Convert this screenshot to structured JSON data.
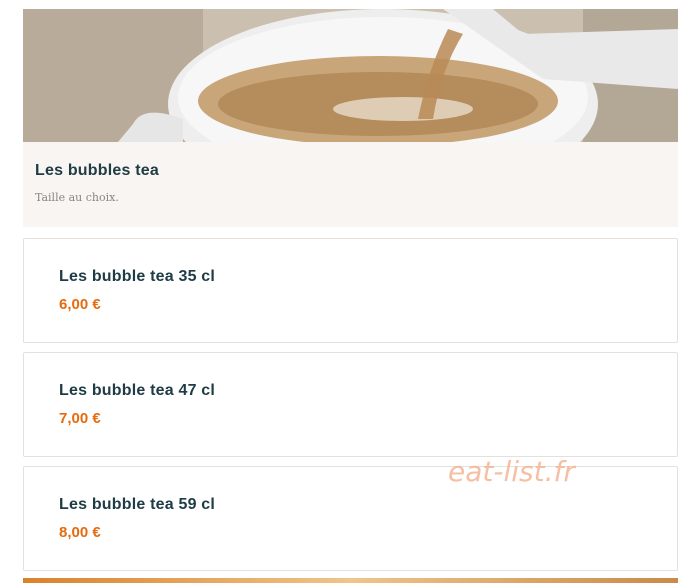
{
  "category": {
    "image_alt_icon": "tea-cup-image",
    "title": "Les bubbles tea",
    "description": "Taille au choix."
  },
  "items": [
    {
      "name": "Les bubble tea 35 cl",
      "price": "6,00 €"
    },
    {
      "name": "Les bubble tea 47 cl",
      "price": "7,00 €"
    },
    {
      "name": "Les bubble tea 59 cl",
      "price": "8,00 €"
    }
  ],
  "watermark": "eat-list.fr",
  "colors": {
    "title": "#1f3b45",
    "price": "#e56b0f",
    "category_bg": "#f8f5f2"
  }
}
